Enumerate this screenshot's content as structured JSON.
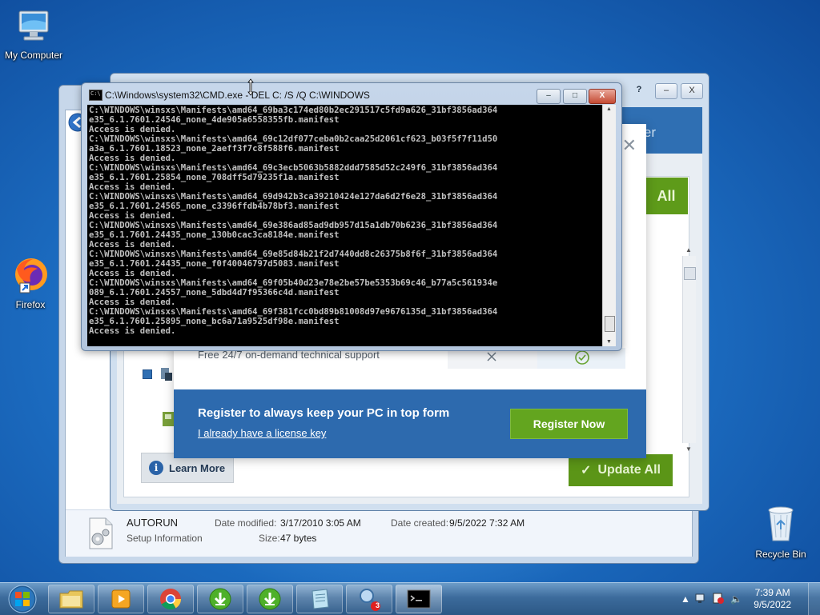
{
  "desktop": {
    "icons": [
      {
        "label": "My Computer"
      },
      {
        "label": "Firefox"
      },
      {
        "label": "Recycle Bin"
      }
    ]
  },
  "explorer": {
    "details": {
      "file_name": "AUTORUN",
      "file_type": "Setup Information",
      "date_modified_label": "Date modified:",
      "date_modified_value": "3/17/2010 3:05 AM",
      "date_created_label": "Date created:",
      "date_created_value": "9/5/2022 7:32 AM",
      "size_label": "Size:",
      "size_value": "47 bytes"
    }
  },
  "updater_app": {
    "header_partial_text": "ter",
    "update_all_top": "All",
    "learn_more": "Learn More",
    "update_all": "Update All",
    "window_buttons": [
      "?",
      "–",
      "X"
    ],
    "colors": {
      "header_blue": "#2f6fb3",
      "action_green": "#5b9517"
    }
  },
  "popup": {
    "feature_text": "Free 24/7 on-demand technical support",
    "register_heading": "Register to always keep your PC in top form",
    "license_link": "I already have a license key",
    "register_button": "Register Now",
    "colors": {
      "banner_blue": "#2d6aae",
      "button_green": "#63a51f"
    }
  },
  "cmd": {
    "title": "C:\\Windows\\system32\\CMD.exe - DEL  C: /S /Q C:\\WINDOWS",
    "lines": [
      "C:\\WINDOWS\\winsxs\\Manifests\\amd64_69ba3c174ed80b2ec291517c5fd9a626_31bf3856ad364",
      "e35_6.1.7601.24546_none_4de905a6558355fb.manifest",
      "Access is denied.",
      "C:\\WINDOWS\\winsxs\\Manifests\\amd64_69c12df077ceba0b2caa25d2061cf623_b03f5f7f11d50",
      "a3a_6.1.7601.18523_none_2aeff3f7c8f588f6.manifest",
      "Access is denied.",
      "C:\\WINDOWS\\winsxs\\Manifests\\amd64_69c3ecb5063b5882ddd7585d52c249f6_31bf3856ad364",
      "e35_6.1.7601.25854_none_708dff5d79235f1a.manifest",
      "Access is denied.",
      "C:\\WINDOWS\\winsxs\\Manifests\\amd64_69d942b3ca39210424e127da6d2f6e28_31bf3856ad364",
      "e35_6.1.7601.24565_none_c3396ffdb4b78bf3.manifest",
      "Access is denied.",
      "C:\\WINDOWS\\winsxs\\Manifests\\amd64_69e386ad85ad9db957d15a1db70b6236_31bf3856ad364",
      "e35_6.1.7601.24435_none_130b0cac3ca8184e.manifest",
      "Access is denied.",
      "C:\\WINDOWS\\winsxs\\Manifests\\amd64_69e85d84b21f2d7440dd8c26375b8f6f_31bf3856ad364",
      "e35_6.1.7601.24435_none_f0f40046797d5083.manifest",
      "Access is denied.",
      "C:\\WINDOWS\\winsxs\\Manifests\\amd64_69f05b40d23e78e2be57be5353b69c46_b77a5c561934e",
      "089_6.1.7601.24557_none_5dbd4d7f95366c4d.manifest",
      "Access is denied.",
      "C:\\WINDOWS\\winsxs\\Manifests\\amd64_69f381fcc0bd89b81008d97e9676135d_31bf3856ad364",
      "e35_6.1.7601.25895_none_bc6a71a9525df98e.manifest",
      "Access is denied."
    ]
  },
  "taskbar": {
    "items": [
      "start-orb",
      "explorer",
      "media-player",
      "chrome",
      "download-1",
      "download-2",
      "notepad",
      "security-app",
      "cmd"
    ],
    "security_badge": "3",
    "clock_time": "7:39 AM",
    "clock_date": "9/5/2022"
  }
}
